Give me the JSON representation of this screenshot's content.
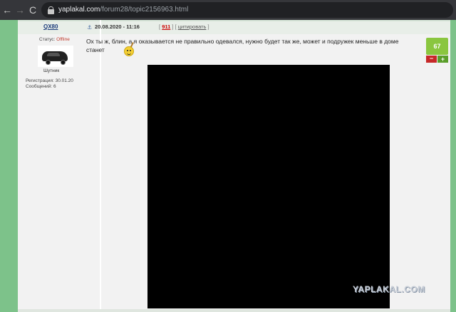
{
  "browser": {
    "url_domain": "yaplakal.com",
    "url_path": "/forum28/topic2156963.html",
    "back_icon": "arrow-left-icon",
    "forward_icon": "arrow-right-icon",
    "reload_icon": "reload-icon",
    "back_glyph": "←",
    "forward_glyph": "→",
    "reload_glyph": "C"
  },
  "user": {
    "name": "QX80",
    "status_label": "Статус:",
    "status_value": "Offline",
    "rank": "Шутник",
    "registration": "Регистрация: 30.01.20",
    "messages": "Сообщений: 6"
  },
  "post": {
    "date": "20.08.2020 - 11:16",
    "open_bracket": "[",
    "post_number": "911",
    "separator": "] [",
    "quote_label": "цитировать",
    "close_bracket": "]",
    "text": "Ох ты ж, блин, а я оказывается не правильно одевался, нужно будет так же, может и подружек меньше в доме станет",
    "rating": "67",
    "vote_minus": "−",
    "vote_plus": "+"
  },
  "watermark": "YAPLAKAL.COM",
  "colors": {
    "side_green": "#7dc28a",
    "rating_green": "#8ac63f",
    "offline_red": "#c0392b",
    "link_blue": "#1b3b7a"
  }
}
